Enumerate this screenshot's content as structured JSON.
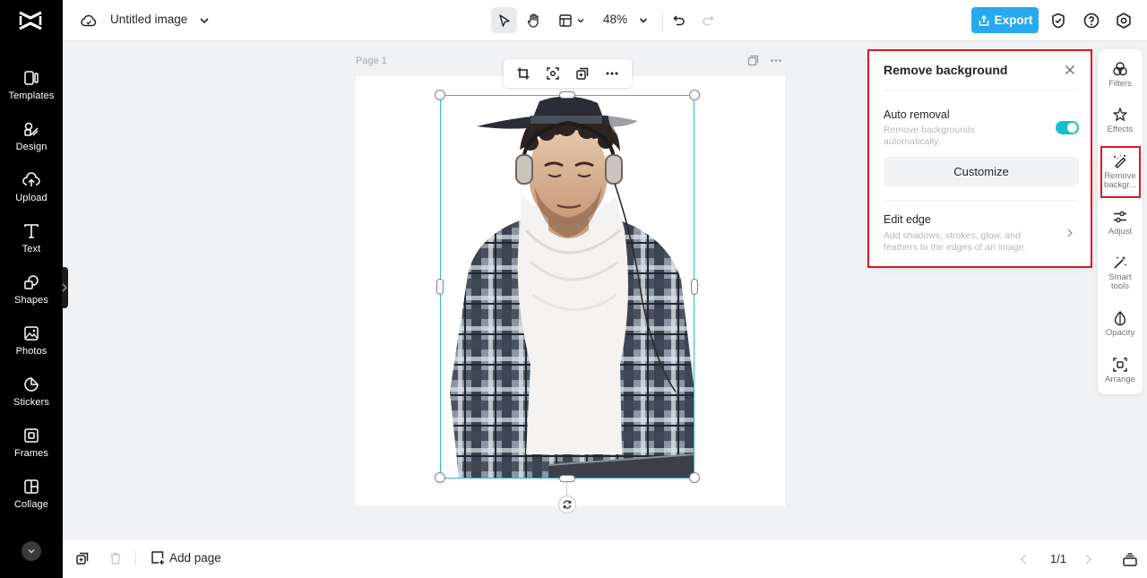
{
  "app": {
    "logo": "capcut-logo"
  },
  "sidebar": {
    "items": [
      {
        "label": "Templates",
        "icon": "templates-icon"
      },
      {
        "label": "Design",
        "icon": "design-icon"
      },
      {
        "label": "Upload",
        "icon": "upload-icon"
      },
      {
        "label": "Text",
        "icon": "text-icon"
      },
      {
        "label": "Shapes",
        "icon": "shapes-icon"
      },
      {
        "label": "Photos",
        "icon": "photos-icon"
      },
      {
        "label": "Stickers",
        "icon": "stickers-icon"
      },
      {
        "label": "Frames",
        "icon": "frames-icon"
      },
      {
        "label": "Collage",
        "icon": "collage-icon"
      }
    ]
  },
  "header": {
    "title": "Untitled image",
    "zoom": "48%",
    "export_label": "Export"
  },
  "canvas": {
    "page_label": "Page 1"
  },
  "panel": {
    "title": "Remove background",
    "auto_removal": {
      "title": "Auto removal",
      "desc_line1": "Remove backgrounds",
      "desc_line2": "automatically.",
      "enabled": true
    },
    "customize_label": "Customize",
    "edit_edge": {
      "title": "Edit edge",
      "desc_line1": "Add shadows, strokes, glow, and",
      "desc_line2": "feathers to the edges of an image."
    }
  },
  "right_tools": {
    "items": [
      {
        "line1": "Filters",
        "line2": ""
      },
      {
        "line1": "Effects",
        "line2": ""
      },
      {
        "line1": "Remove",
        "line2": "backgr..."
      },
      {
        "line1": "Adjust",
        "line2": ""
      },
      {
        "line1": "Smart",
        "line2": "tools"
      },
      {
        "line1": "Opacity",
        "line2": ""
      },
      {
        "line1": "Arrange",
        "line2": ""
      }
    ]
  },
  "footer": {
    "add_page_label": "Add page",
    "page_count": "1/1"
  },
  "colors": {
    "accent": "#27a9f0",
    "toggle_on": "#14c0cf",
    "selection": "#27b9d4",
    "highlight": "#e0161e",
    "sidebar_bg": "#000000"
  }
}
